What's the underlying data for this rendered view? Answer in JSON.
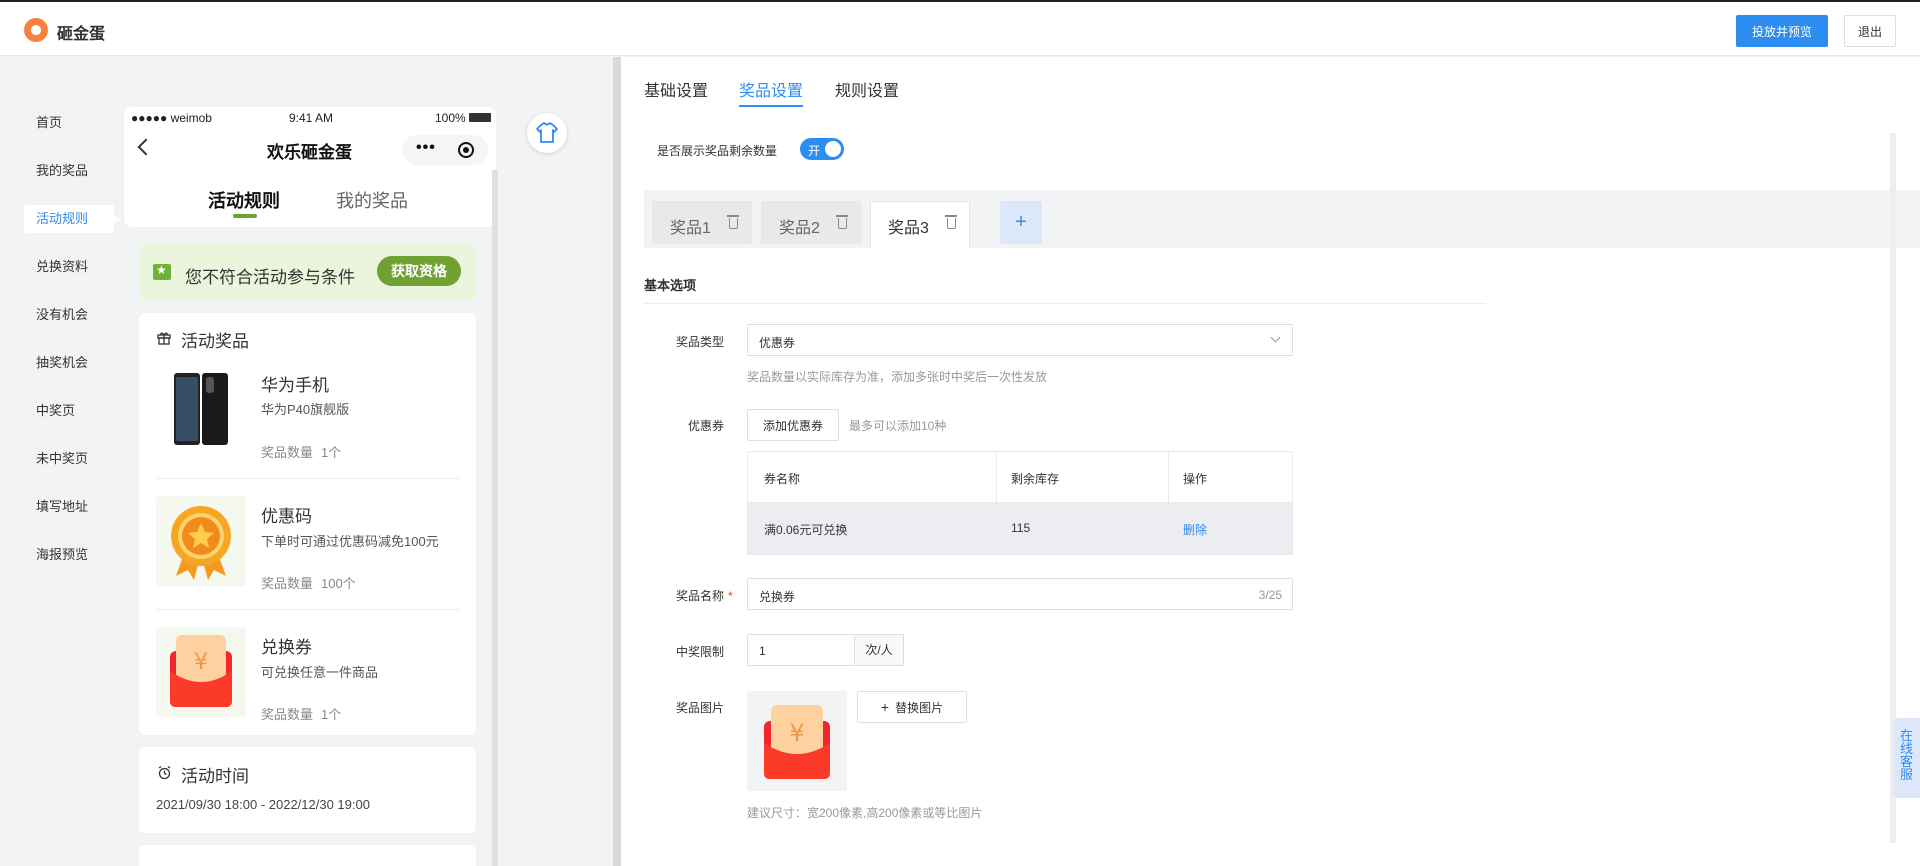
{
  "app": {
    "title": "砸金蛋"
  },
  "header": {
    "publish_label": "投放并预览",
    "exit_label": "退出"
  },
  "left_nav": {
    "items": [
      {
        "label": "首页"
      },
      {
        "label": "我的奖品"
      },
      {
        "label": "活动规则"
      },
      {
        "label": "兑换资料"
      },
      {
        "label": "没有机会"
      },
      {
        "label": "抽奖机会"
      },
      {
        "label": "中奖页"
      },
      {
        "label": "未中奖页"
      },
      {
        "label": "填写地址"
      },
      {
        "label": "海报预览"
      }
    ],
    "active_index": 2
  },
  "phone": {
    "status": {
      "carrier": "●●●●● weimob",
      "time": "9:41 AM",
      "battery": "100%"
    },
    "title": "欢乐砸金蛋",
    "tabs": [
      {
        "label": "活动规则"
      },
      {
        "label": "我的奖品"
      }
    ],
    "condition": {
      "text": "您不符合活动参与条件",
      "button": "获取资格"
    },
    "prizes_card": {
      "title": "活动奖品",
      "qty_label": "奖品数量",
      "items": [
        {
          "name": "华为手机",
          "desc": "华为P40旗舰版",
          "qty": "1个"
        },
        {
          "name": "优惠码",
          "desc": "下单时可通过优惠码减免100元",
          "qty": "100个"
        },
        {
          "name": "兑换券",
          "desc": "可兑换任意一件商品",
          "qty": "1个"
        }
      ]
    },
    "time_card": {
      "title": "活动时间",
      "value": "2021/09/30 18:00 - 2022/12/30 19:00"
    }
  },
  "tabs": [
    {
      "label": "基础设置"
    },
    {
      "label": "奖品设置"
    },
    {
      "label": "规则设置"
    }
  ],
  "show_remaining": {
    "label": "是否展示奖品剩余数量",
    "toggle_text": "开",
    "on": true
  },
  "prize_tabs": [
    {
      "label": "奖品1"
    },
    {
      "label": "奖品2"
    },
    {
      "label": "奖品3"
    }
  ],
  "prize_tabs_active": 2,
  "basic": {
    "section_title": "基本选项",
    "prize_type": {
      "label": "奖品类型",
      "value": "优惠券",
      "hint": "奖品数量以实际库存为准，添加多张时中奖后一次性发放"
    },
    "coupon": {
      "label": "优惠券",
      "add_button": "添加优惠券",
      "hint": "最多可以添加10种",
      "columns": [
        "券名称",
        "剩余库存",
        "操作"
      ],
      "rows": [
        {
          "name": "满0.06元可兑换",
          "stock": "115",
          "action": "删除"
        }
      ]
    },
    "prize_name": {
      "label": "奖品名称",
      "required": "*",
      "value": "兑换券",
      "counter": "3/25"
    },
    "win_limit": {
      "label": "中奖限制",
      "value": "1",
      "unit": "次/人"
    },
    "prize_image": {
      "label": "奖品图片",
      "replace_button": "替换图片",
      "hint": "建议尺寸：宽200像素,高200像素或等比图片"
    }
  },
  "service": {
    "label": "在线客服"
  },
  "colors": {
    "primary": "#2d8cf0",
    "green": "#6fa232",
    "logo": "#f5813f"
  }
}
